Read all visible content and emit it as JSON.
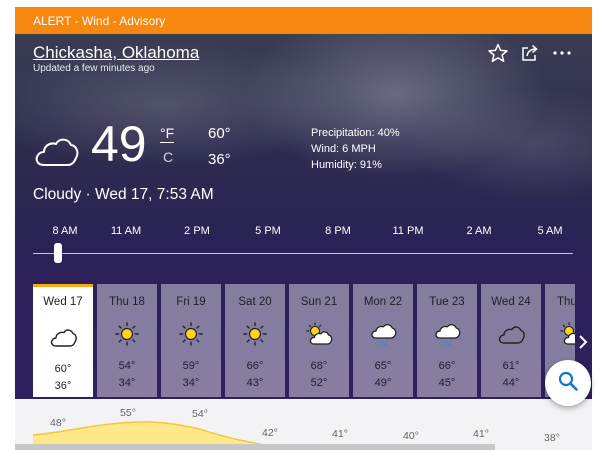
{
  "alert": {
    "text": "ALERT - Wind - Advisory"
  },
  "location": {
    "name": "Chickasha, Oklahoma",
    "updated": "Updated a few minutes ago"
  },
  "actions": {
    "icons": [
      "star-icon",
      "share-icon",
      "more-icon"
    ]
  },
  "current": {
    "temp": "49",
    "unit_f": "°F",
    "unit_c": "C",
    "high": "60°",
    "low": "36°",
    "precipitation": "Precipitation: 40%",
    "wind": "Wind: 6 MPH",
    "humidity": "Humidity: 91%",
    "condition": "Cloudy · Wed 17, 7:53 AM",
    "icon": "cloud-icon"
  },
  "timeline": {
    "hours": [
      "8 AM",
      "11 AM",
      "2 PM",
      "5 PM",
      "8 PM",
      "11 PM",
      "2 AM",
      "5 AM"
    ],
    "selected_hour": "8 AM"
  },
  "days": [
    {
      "name": "Wed 17",
      "hi": "60°",
      "lo": "36°",
      "icon": "cloud-icon",
      "selected": true
    },
    {
      "name": "Thu 18",
      "hi": "54°",
      "lo": "34°",
      "icon": "sun-icon"
    },
    {
      "name": "Fri 19",
      "hi": "59°",
      "lo": "34°",
      "icon": "sun-icon"
    },
    {
      "name": "Sat 20",
      "hi": "66°",
      "lo": "43°",
      "icon": "sun-icon"
    },
    {
      "name": "Sun 21",
      "hi": "68°",
      "lo": "52°",
      "icon": "partly-sunny-icon"
    },
    {
      "name": "Mon 22",
      "hi": "65°",
      "lo": "49°",
      "icon": "rain-cloud-icon"
    },
    {
      "name": "Tue 23",
      "hi": "66°",
      "lo": "45°",
      "icon": "rain-cloud-icon"
    },
    {
      "name": "Wed 24",
      "hi": "61°",
      "lo": "44°",
      "icon": "cloud-icon"
    },
    {
      "name": "Thu",
      "icon": "partly-sunny-icon"
    }
  ],
  "graph_labels": [
    "48°",
    "55°",
    "54°",
    "42°",
    "41°",
    "40°",
    "41°",
    "38°"
  ],
  "colors": {
    "alert": "#f7880f",
    "selected_accent": "#f7aa17",
    "search_icon": "#0f77c8",
    "graph_fill": "#ffe98a",
    "graph_line": "#f3c63b"
  }
}
